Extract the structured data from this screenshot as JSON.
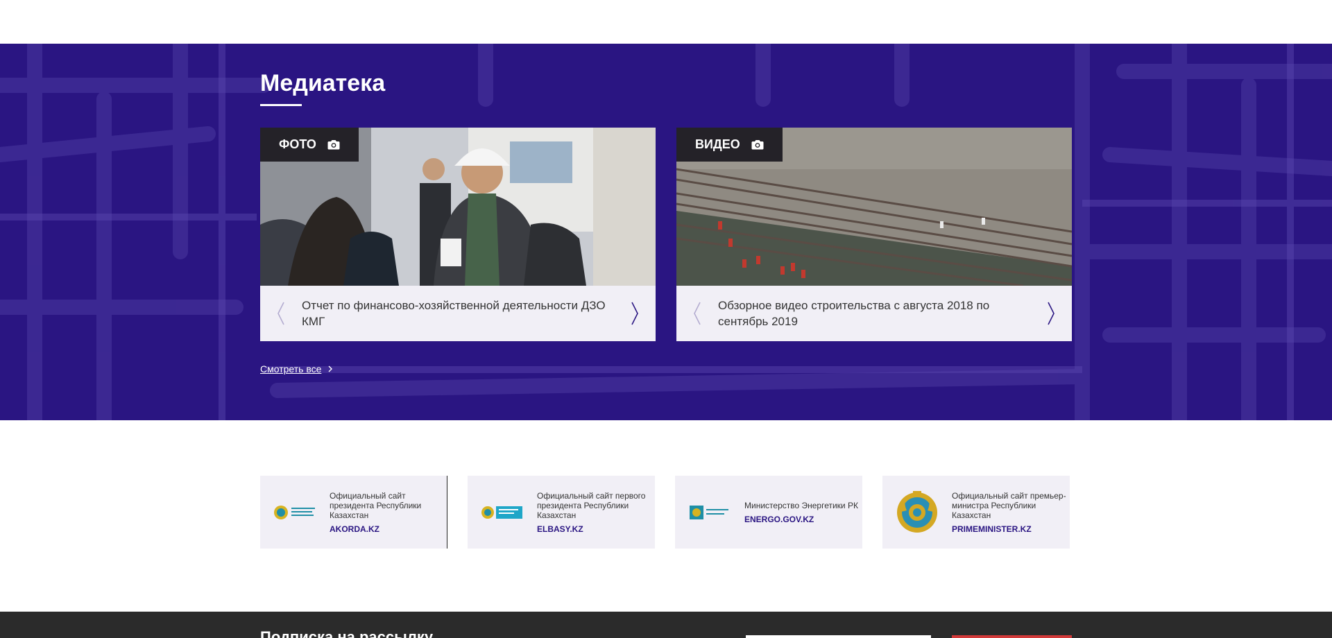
{
  "media": {
    "title": "Медиатека",
    "see_all": "Смотреть все",
    "cards": [
      {
        "tag": "ФОТО",
        "icon": "camera-icon",
        "caption": "Отчет по финансово-хозяйственной деятельности ДЗО КМГ"
      },
      {
        "tag": "ВИДЕО",
        "icon": "camera-icon",
        "caption": "Обзорное видео строительства с августа 2018 по сентябрь 2019"
      }
    ]
  },
  "partners": [
    {
      "desc": "Официальный сайт президента Республики Казахстан",
      "domain": "AKORDA.KZ"
    },
    {
      "desc": "Официальный сайт первого президента Республики Казахстан",
      "domain": "ELBASY.KZ"
    },
    {
      "desc": "Министерство Энергетики РК",
      "domain": "ENERGO.GOV.KZ"
    },
    {
      "desc": "Официальный сайт премьер-министра Республики Казахстан",
      "domain": "PRIMEMINISTER.KZ"
    }
  ],
  "footer": {
    "title": "Подписка на рассылку"
  },
  "colors": {
    "brand_purple": "#2a1582",
    "card_bg": "#f1eff6",
    "tag_bg": "#242228",
    "footer_bg": "#2b2b2b",
    "button_red": "#d23a3a"
  }
}
